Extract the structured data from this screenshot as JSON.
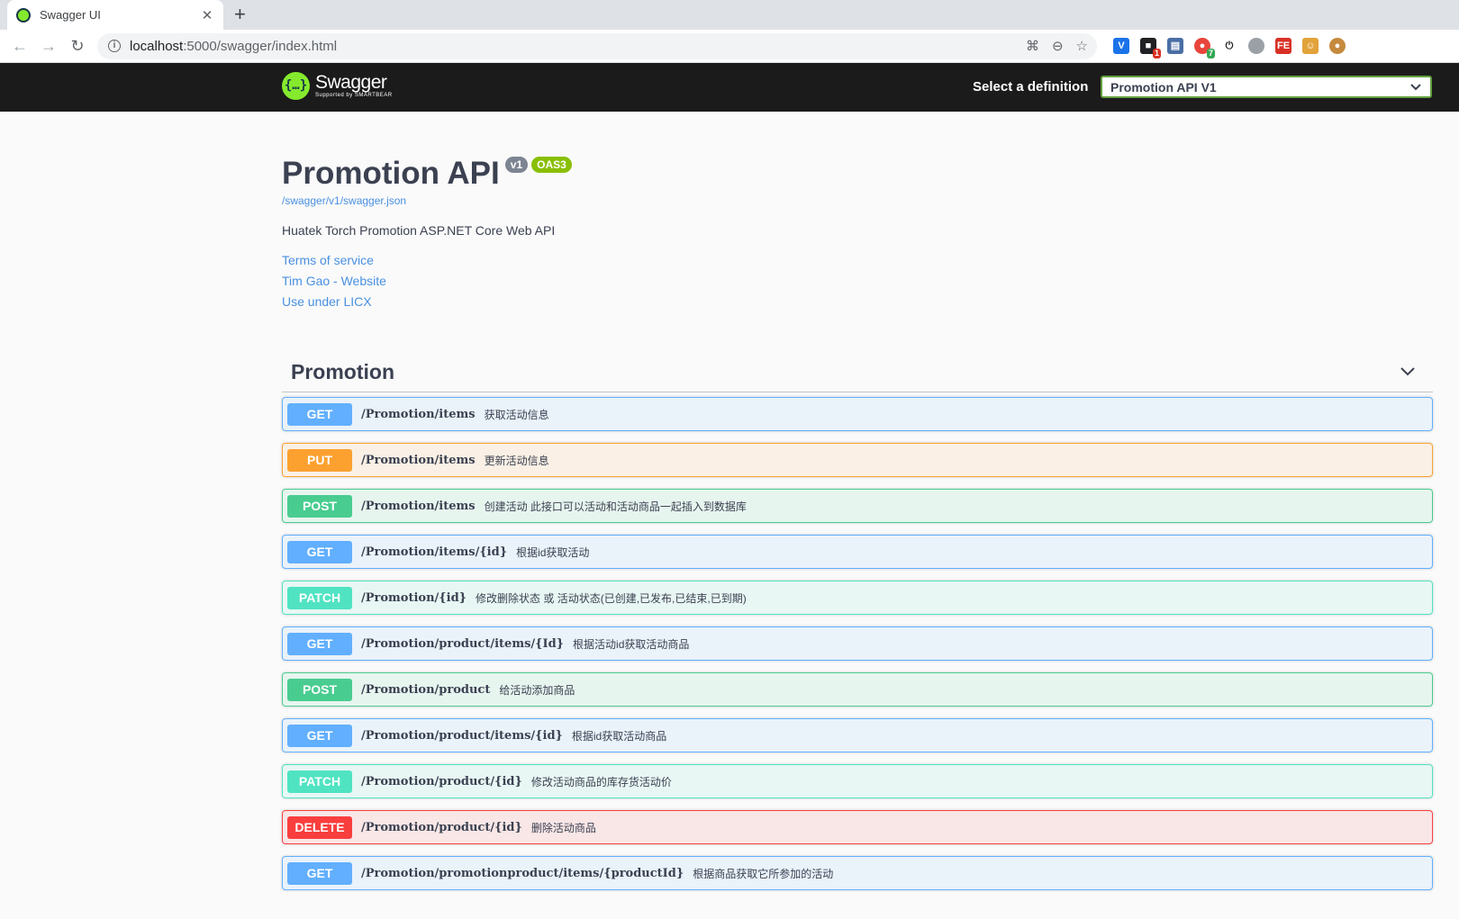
{
  "browser": {
    "tab_title": "Swagger UI",
    "url_host": "localhost",
    "url_rest": ":5000/swagger/index.html",
    "ext_badges": [
      "1",
      "7"
    ]
  },
  "topbar": {
    "brand": "Swagger",
    "brand_sub": "Supported by SMARTBEAR",
    "definition_label": "Select a definition",
    "definition_value": "Promotion API V1"
  },
  "info": {
    "title": "Promotion API",
    "version": "v1",
    "oas": "OAS3",
    "spec_url": "/swagger/v1/swagger.json",
    "description": "Huatek Torch Promotion ASP.NET Core Web API",
    "links": [
      "Terms of service",
      "Tim Gao - Website",
      "Use under LICX"
    ]
  },
  "tag": {
    "name": "Promotion"
  },
  "operations": [
    {
      "method": "GET",
      "path": "/Promotion/items",
      "summary": "获取活动信息"
    },
    {
      "method": "PUT",
      "path": "/Promotion/items",
      "summary": "更新活动信息"
    },
    {
      "method": "POST",
      "path": "/Promotion/items",
      "summary": "创建活动 此接口可以活动和活动商品一起插入到数据库"
    },
    {
      "method": "GET",
      "path": "/Promotion/items/{id}",
      "summary": "根据id获取活动"
    },
    {
      "method": "PATCH",
      "path": "/Promotion/{id}",
      "summary": "修改删除状态 或 活动状态(已创建,已发布,已结束,已到期)"
    },
    {
      "method": "GET",
      "path": "/Promotion/product/items/{Id}",
      "summary": "根据活动id获取活动商品"
    },
    {
      "method": "POST",
      "path": "/Promotion/product",
      "summary": "给活动添加商品"
    },
    {
      "method": "GET",
      "path": "/Promotion/product/items/{id}",
      "summary": "根据id获取活动商品"
    },
    {
      "method": "PATCH",
      "path": "/Promotion/product/{id}",
      "summary": "修改活动商品的库存货活动价"
    },
    {
      "method": "DELETE",
      "path": "/Promotion/product/{id}",
      "summary": "删除活动商品"
    },
    {
      "method": "GET",
      "path": "/Promotion/promotionproduct/items/{productId}",
      "summary": "根据商品获取它所参加的活动"
    }
  ]
}
